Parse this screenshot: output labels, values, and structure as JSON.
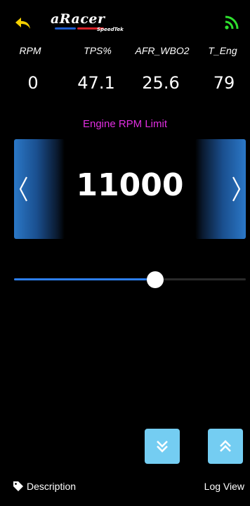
{
  "header": {
    "logo_main": "aRacer",
    "logo_sub": "SpeedTek",
    "back_icon": "back-arrow-icon",
    "signal_icon": "signal-icon",
    "colors": {
      "back": "#f5d000",
      "signal": "#2ee02e"
    }
  },
  "metrics": [
    {
      "label": "RPM",
      "value": "0"
    },
    {
      "label": "TPS%",
      "value": "47.1"
    },
    {
      "label": "AFR_WBO2",
      "value": "25.6"
    },
    {
      "label": "T_Eng",
      "value": "79"
    }
  ],
  "parameter": {
    "title": "Engine RPM Limit",
    "value": "11000",
    "title_color": "#e02ee0"
  },
  "slider": {
    "fraction": 0.61
  },
  "buttons": {
    "prev_icon": "chevron-left-icon",
    "next_icon": "chevron-right-icon",
    "step_down_icon": "double-chevron-down-icon",
    "step_up_icon": "double-chevron-up-icon",
    "accent": "#74cdf2"
  },
  "footer": {
    "description_label": "Description",
    "log_view_label": "Log View",
    "tag_icon": "tag-icon"
  }
}
